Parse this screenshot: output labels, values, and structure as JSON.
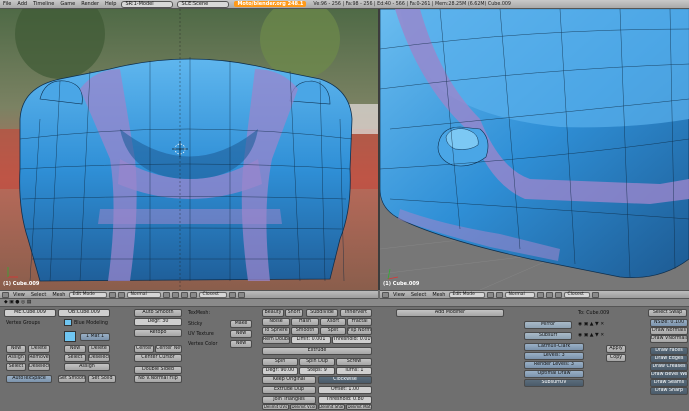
{
  "topbar": {
    "menus": [
      "File",
      "Add",
      "Timeline",
      "Game",
      "Render",
      "Help"
    ],
    "screen": "SR:1-Model",
    "scene": "SCE:Scene",
    "file_title": "Moto/blender.org 248.1",
    "stats": "Ve:96 - 256 | Fa:98 - 256 | Ed:40 - 566 | Fa:0-261 | Mem:28.25M (6.62M) Cube.009"
  },
  "viewport_left": {
    "object_label": "(1) Cube.009"
  },
  "viewport_right": {
    "object_label": "(1) Cube.009"
  },
  "header_left": {
    "items": [
      "View",
      "Select",
      "Mesh"
    ],
    "mode": "Edit Mode",
    "pivot": "Normal",
    "shading": "Closest"
  },
  "header_right": {
    "items": [
      "View",
      "Select",
      "Mesh"
    ],
    "mode": "Edit Mode",
    "pivot": "Normal",
    "shading": "Closest"
  },
  "link_panel": {
    "me_field": "ME:Cube.009",
    "ob_field": "OB:Cube.009",
    "vertex_groups": "Vertex Groups",
    "material": "Blue Modeling",
    "mat_index": "1 Mat 1",
    "buttons": [
      "New",
      "Delete",
      "Assign",
      "Remove",
      "Select",
      "Deselect",
      "New",
      "Delete",
      "Select",
      "Deselect",
      "Assign"
    ],
    "autotexspace": "AutoTexSpace",
    "set_smooth": "Set Smooth",
    "set_solid": "Set Solid"
  },
  "mesh_panel": {
    "auto_smooth": "Auto Smooth",
    "degr": "Degr: 30",
    "retopo": "Retopo",
    "center": "Center",
    "center_new": "Center New",
    "center_cursor": "Center Cursor",
    "double_sided": "Double Sided",
    "no_vnormal_flip": "No V.Normal Flip",
    "texmesh": "TexMesh:",
    "sticky": "Sticky",
    "uv_texture": "UV Texture",
    "vertex_color": "Vertex Color",
    "make": "Make",
    "new1": "New",
    "new2": "New"
  },
  "meshtools": {
    "beauty": "Beauty",
    "short": "Short",
    "subdivide": "Subdivide",
    "innervert": "Innervert",
    "noise": "Noise",
    "hash": "Hash",
    "xsort": "Xsort",
    "fractal": "Fractal",
    "to_sphere": "To Sphere",
    "smooth": "Smooth",
    "split": "Split",
    "flip_normals": "Flip Normals",
    "rem_doubles": "Rem Doubles",
    "limit": "Limit: 0.001",
    "threshold": "Threshold: 0.010",
    "extrude": "Extrude",
    "spin": "Spin",
    "spin_dup": "Spin Dup",
    "screw": "Screw",
    "degr": "Degr: 90.00",
    "steps": "Steps: 9",
    "turns": "Turns: 1",
    "keep_original": "Keep Original",
    "clockwise": "Clockwise",
    "extrude_dup": "Extrude Dup",
    "offset": "Offset: 1.00",
    "join_triangles": "Join Triangles",
    "threshold_join": "Threshold: 0.80",
    "delimit_uvs": "Delimit UVs",
    "delimit_vcol": "Delimit Vcol",
    "delimit_sharp": "Delimit Sharp",
    "delimit_mat": "Delimit Mat"
  },
  "modifiers": {
    "add_modifier": "Add Modifier",
    "to": "To: Cube.009",
    "mirror": "Mirror",
    "subsurf": "Subsurf",
    "type": "Catmull-Clark",
    "levels": "Levels: 3",
    "render_levels": "Render Levels: 3",
    "optimal_draw": "Optimal Draw",
    "subsurf_uv": "SubsurfUV",
    "apply": "Apply",
    "copy": "Copy"
  },
  "snap_panel": {
    "select_swap": "Select Swap",
    "items": [
      "NSize: 0.100",
      "Draw Normals",
      "Draw VNormals",
      "Draw Faces",
      "Draw Edges",
      "Draw Creases",
      "Draw Bevel Wei",
      "Draw Seams",
      "Draw Sharp"
    ]
  },
  "colors": {
    "mesh_blue": "#2f8fd6",
    "mesh_dark": "#1f5f9a",
    "crease_purple": "#9a86cc",
    "title_orange": "#ff9a1a",
    "panel_bg": "#6f6f6f"
  }
}
